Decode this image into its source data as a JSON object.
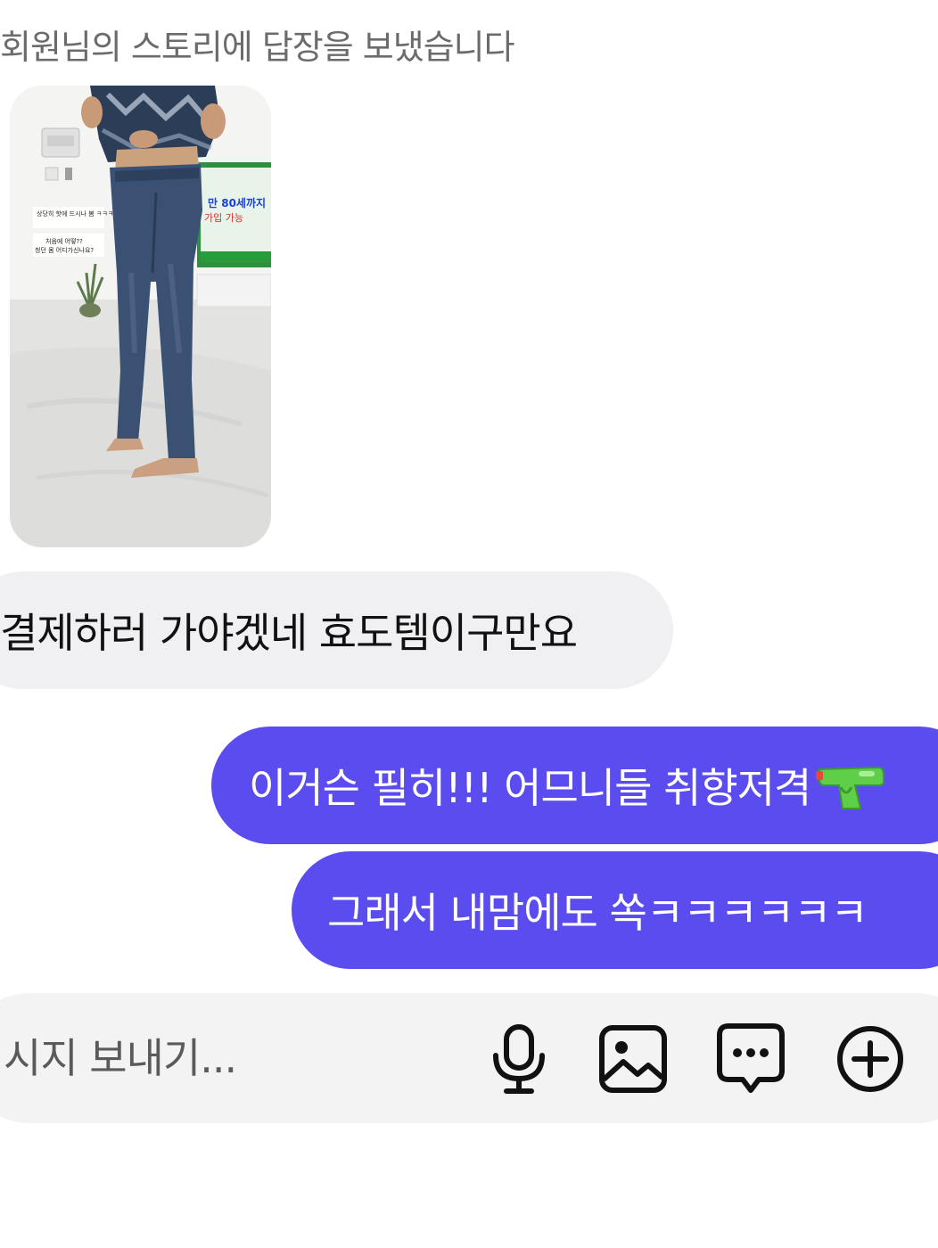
{
  "story_reply": {
    "label": "회원님의 스토리에 답장을 보냈습니다",
    "image": {
      "overlay_text_1": "상당히 핫에 드시나 봄 ㅋㅋㅋㅋㅋ",
      "overlay_text_2": "처음에 어떻??",
      "overlay_text_3": "청던 몸 어디가신나요?",
      "tv_text_1": "만 80세까지",
      "tv_text_2": "가입 가능"
    }
  },
  "messages": [
    {
      "direction": "received",
      "text": "결제하러 가야겠네 효도템이구만요"
    },
    {
      "direction": "sent",
      "text": "이거슨 필히!!! 어므니들 취향저격",
      "emoji": "water-pistol"
    },
    {
      "direction": "sent",
      "text": "그래서 내맘에도 쏙ㅋㅋㅋㅋㅋㅋ"
    }
  ],
  "composer": {
    "placeholder": "시지 보내기...",
    "icons": [
      "microphone-icon",
      "image-icon",
      "sticker-icon",
      "plus-circle-icon"
    ]
  },
  "colors": {
    "sent_bubble": "#5b4cf0",
    "received_bubble": "#f0f0f2",
    "composer_bg": "#f3f3f3"
  }
}
